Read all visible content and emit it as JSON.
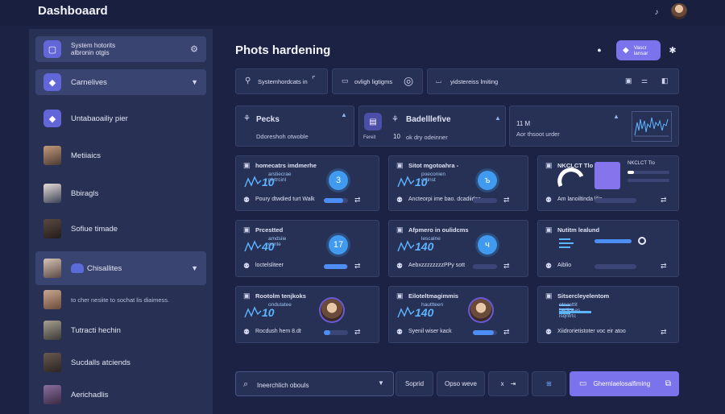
{
  "app": {
    "title": "Dashboaard"
  },
  "header": {
    "page_title": "Phots hardening",
    "primary_button_label": "Vascr\nlansar"
  },
  "sidebar": {
    "items": [
      {
        "label": "System hotorits\nalbronin otgis",
        "icon": "square-icon"
      },
      {
        "label": "Carnelives",
        "icon": "diamond-icon"
      },
      {
        "label": "Untabaoailiy pier",
        "icon": "diamond-icon"
      },
      {
        "label": "Metiiaics"
      },
      {
        "label": "Bbiragls"
      },
      {
        "label": "Sofiue timade"
      },
      {
        "label": "Chisallites"
      },
      {
        "label": "to cher nesiite to sochat lis diaimess."
      },
      {
        "label": "Tutracti hechin"
      },
      {
        "label": "Sucdalls atciends"
      },
      {
        "label": "Aerichadlis"
      }
    ]
  },
  "toolbar": {
    "field1": "Systemhordcats in",
    "field2": "ovligh ligtigms",
    "field3": "yidstereiss lmiting"
  },
  "stats": {
    "card1": {
      "title": "Pecks",
      "subtitle": "Ddoreshoh otwoble"
    },
    "card2": {
      "title": "Badelllefive",
      "subtitle": "ok dry odeinner",
      "num": "10",
      "side_label": "Fereit"
    },
    "card3": {
      "value": "11 M",
      "subtitle": "Aor thsoot urder"
    }
  },
  "cards": [
    {
      "title": "homecatrs imdmerhe",
      "sub": "arstiecrae\nplvtrcinl",
      "num": "10",
      "badge": "3",
      "footer": "Poury dtwdied turt Walk",
      "progress": 0.8
    },
    {
      "title": "Sitot mgotoahra -",
      "sub": "poeconien\nortinst",
      "num": "10",
      "badge": "ъ",
      "footer": "Ancteorpi ime bao. dcadiides",
      "progress": 0.0
    },
    {
      "title": "NKCLCT Tlo",
      "footer": "Am lanoiltinda lilis",
      "progress": 0.15
    },
    {
      "title": "Prcestted",
      "sub": "amdsiie\nconte",
      "num": "40",
      "badge": "17",
      "footer": "loctelsliteer",
      "progress": 0.95
    },
    {
      "title": "Afpmero in oulidcms",
      "sub": "lescalne",
      "num": "140",
      "badge": "ч",
      "footer": "AebxzzzzzzzzPPy sott",
      "progress": 0.0
    },
    {
      "title": "Nutitm lealund",
      "footer": "Aiblio",
      "progress": 0.0
    },
    {
      "title": "Rootolm tenjkoks",
      "sub": "ondutatee",
      "num": "10",
      "footer": "Rocdush hem  8.dt",
      "progress": 0.25
    },
    {
      "title": "Eiloteltmagimmis",
      "sub": "hauttteen",
      "num": "140",
      "footer": "Syenil wiser kack",
      "progress": 0.85
    },
    {
      "title": "Sitsercleyelentom",
      "sub": "otnasttit\nbedioeas\nisqntrtc",
      "footer": "Xiidrorietistoter voc eir atoo",
      "progress": 0.0
    }
  ],
  "bottom": {
    "search_text": "Ineerchlich obouls",
    "btn1": "Soprid",
    "btn2": "Opso weve",
    "btn3": "x",
    "cta": "Ghernlaelosalfiming"
  },
  "colors": {
    "accent": "#7b73ec",
    "progress": "#4d8ef5",
    "badge": "#3f9af0",
    "bg": "#1b2244",
    "panel": "#273055"
  }
}
